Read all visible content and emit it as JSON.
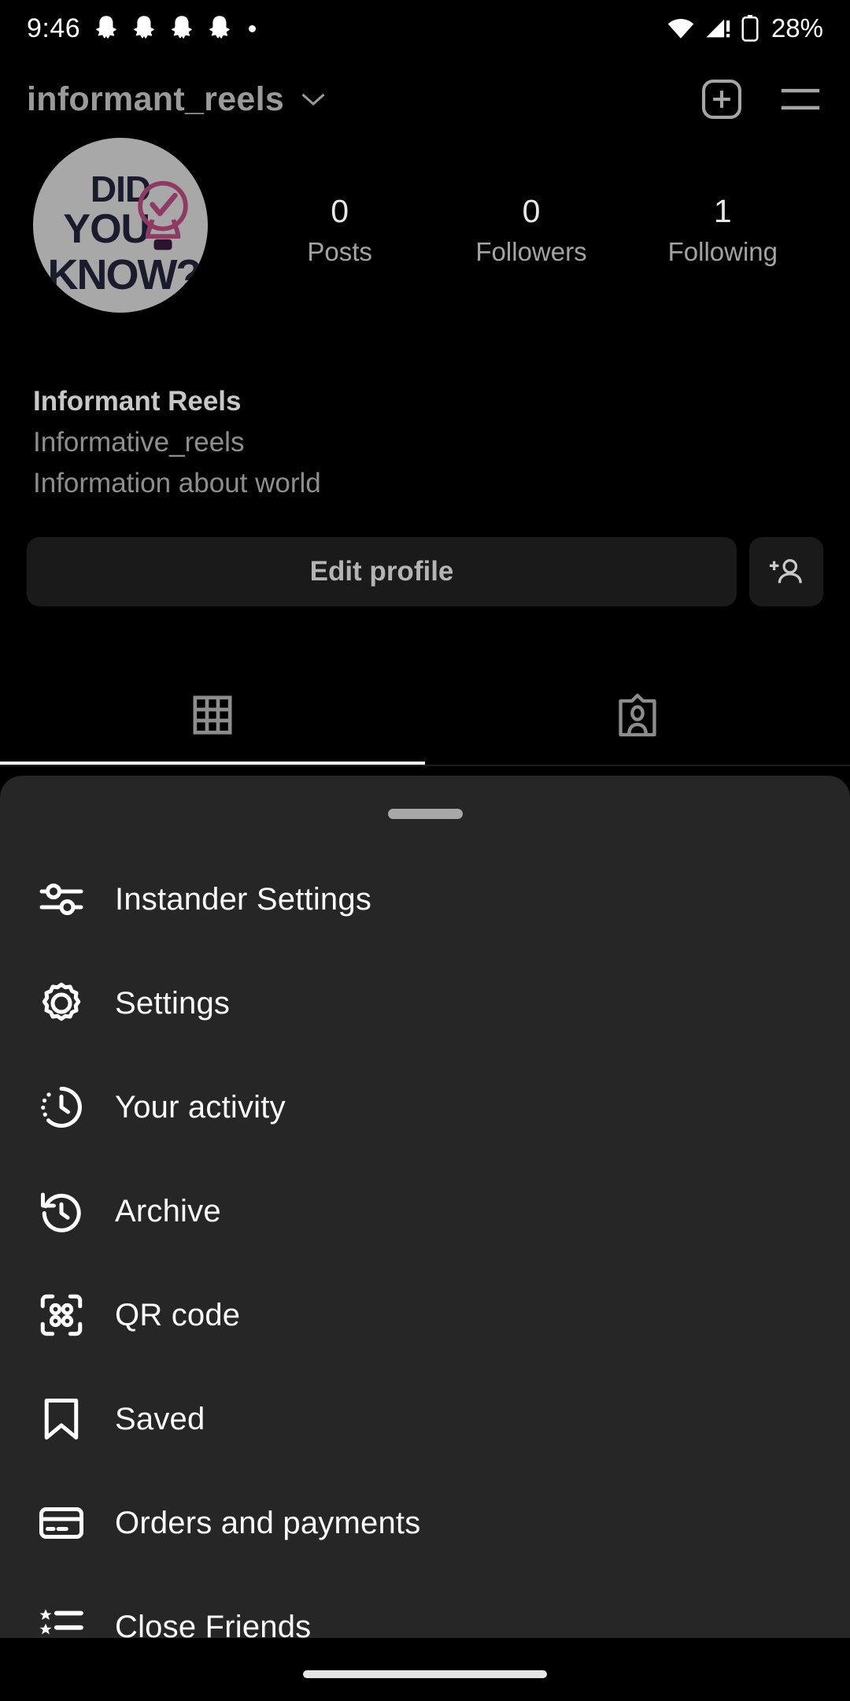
{
  "status_bar": {
    "time": "9:46",
    "app_icons": [
      "snapchat-ghost",
      "snapchat-ghost",
      "snapchat-ghost",
      "snapchat-ghost",
      "overflow-dot"
    ],
    "wifi_icon": "wifi-icon",
    "signal_icon": "cellular-signal-warning-icon",
    "battery_icon": "battery-icon",
    "battery_text": "28%"
  },
  "header": {
    "username": "informant_reels",
    "chevron_icon": "chevron-down-icon",
    "new_post_icon": "plus-box-icon",
    "menu_icon": "hamburger-menu-icon"
  },
  "profile": {
    "avatar": {
      "alt": "profile-picture",
      "line1": "DID",
      "line2": "YOU",
      "line3": "KNOW?",
      "badge_icon": "lightbulb-check-icon",
      "bg_color": "#a8a8a8",
      "text_color": "#1b1b2e",
      "bulb_color": "#8e3a63"
    },
    "stats": [
      {
        "value": "0",
        "label": "Posts"
      },
      {
        "value": "0",
        "label": "Followers"
      },
      {
        "value": "1",
        "label": "Following"
      }
    ],
    "name": "Informant Reels",
    "handle": "Informative_reels",
    "description": "Information about world",
    "edit_profile_label": "Edit profile",
    "add_person_icon": "add-person-icon"
  },
  "tabs": [
    {
      "name": "grid",
      "icon": "grid-icon",
      "active": true
    },
    {
      "name": "tagged",
      "icon": "tagged-person-card-icon",
      "active": false
    }
  ],
  "sheet": {
    "handle": "drag-handle",
    "items": [
      {
        "label": "Instander Settings",
        "icon": "sliders-icon"
      },
      {
        "label": "Settings",
        "icon": "gear-icon"
      },
      {
        "label": "Your activity",
        "icon": "activity-clock-icon"
      },
      {
        "label": "Archive",
        "icon": "archive-clock-icon"
      },
      {
        "label": "QR code",
        "icon": "qr-code-icon"
      },
      {
        "label": "Saved",
        "icon": "bookmark-icon"
      },
      {
        "label": "Orders and payments",
        "icon": "credit-card-icon"
      },
      {
        "label": "Close Friends",
        "icon": "star-list-icon"
      }
    ]
  },
  "navigation_bar": {
    "gesture_pill": "home-gesture-pill"
  },
  "colors": {
    "background": "#000000",
    "sheet_background": "#262626",
    "button_background": "#1a1a1a",
    "primary_text": "#fafafa",
    "secondary_text": "#8e8e8e"
  }
}
